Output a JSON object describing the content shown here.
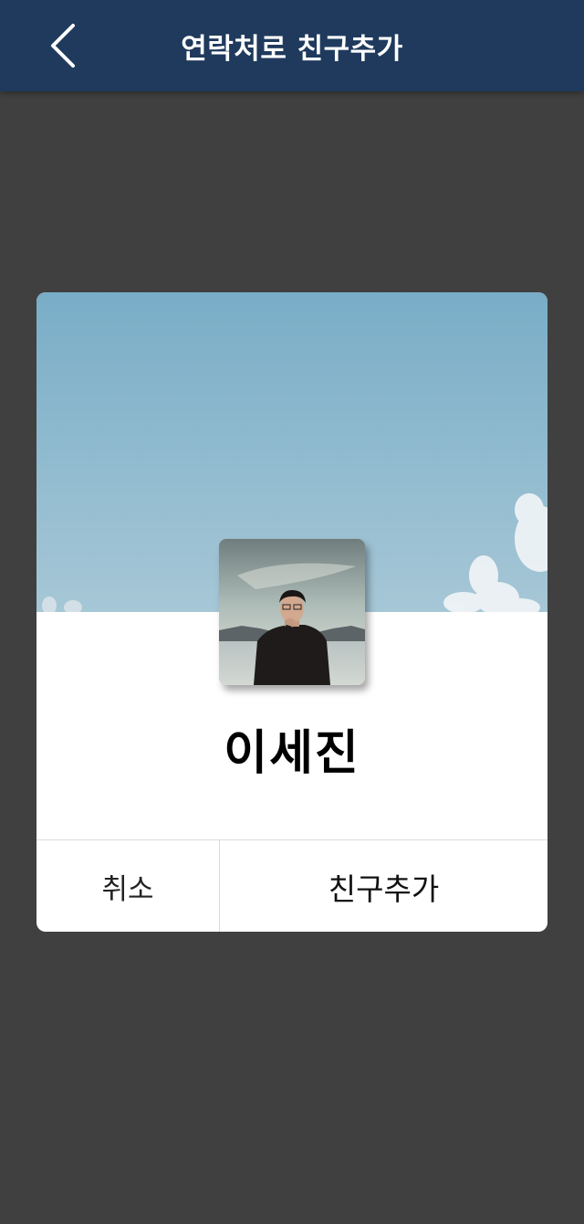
{
  "header": {
    "title": "연락처로 친구추가",
    "back_icon": "chevron-left-icon"
  },
  "profile": {
    "name": "이세진",
    "cover_image": "sky-cover-image",
    "avatar_image": "profile-photo"
  },
  "actions": {
    "cancel_label": "취소",
    "add_label": "친구추가"
  },
  "colors": {
    "header_bg": "#1f3a5c",
    "overlay_bg": "#404040",
    "card_bg": "#ffffff",
    "sky_top": "#7aaec8",
    "sky_bottom": "#a3c6d6"
  }
}
